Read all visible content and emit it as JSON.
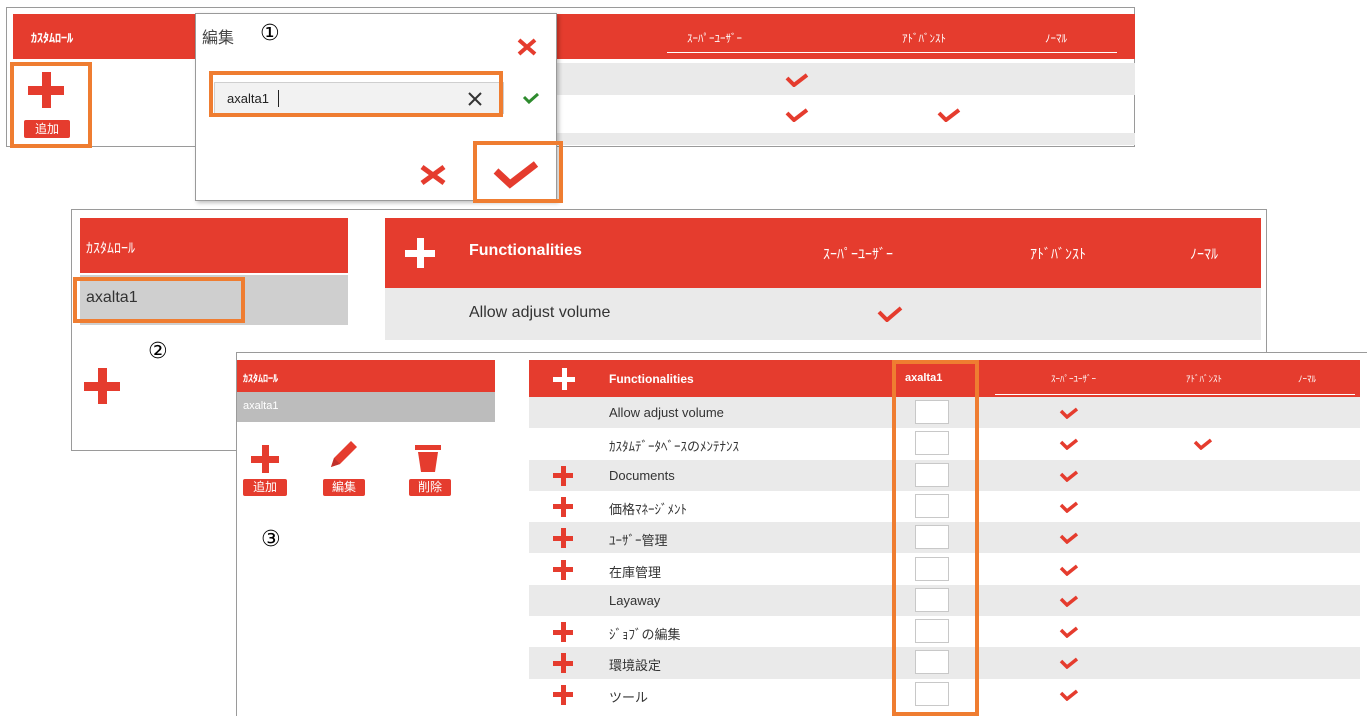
{
  "step_markers": [
    "①",
    "②",
    "③"
  ],
  "colors": {
    "accent": "#e53c2e",
    "highlight": "#ef7d31",
    "green_check": "#2e8b2e",
    "row_grey": "#eaeaea"
  },
  "panel1": {
    "sidebar_title": "ｶｽﾀﾑﾛｰﾙ",
    "add_label": "追加",
    "columns": [
      "ｽｰﾊﾟｰﾕｰｻﾞｰ",
      "ｱﾄﾞﾊﾞﾝｽﾄ",
      "ﾉｰﾏﾙ"
    ]
  },
  "edit_dialog": {
    "title": "編集",
    "input_value": "axalta1",
    "icons": [
      "close-icon",
      "clear-icon",
      "check-icon"
    ]
  },
  "panel2": {
    "sidebar_title": "ｶｽﾀﾑﾛｰﾙ",
    "role_item": "axalta1",
    "header_label": "Functionalities",
    "columns": [
      "ｽｰﾊﾟｰﾕｰｻﾞｰ",
      "ｱﾄﾞﾊﾞﾝｽﾄ",
      "ﾉｰﾏﾙ"
    ],
    "row_label": "Allow adjust volume"
  },
  "panel3": {
    "sidebar_title": "ｶｽﾀﾑﾛｰﾙ",
    "role_item": "axalta1",
    "buttons": {
      "add": "追加",
      "edit": "編集",
      "delete": "削除"
    },
    "header_label": "Functionalities",
    "columns": [
      "axalta1",
      "ｽｰﾊﾟｰﾕｰｻﾞｰ",
      "ｱﾄﾞﾊﾞﾝｽﾄ",
      "ﾉｰﾏﾙ"
    ],
    "rows": [
      {
        "label": "Allow adjust volume",
        "expandable": false,
        "super": true,
        "advanced": false
      },
      {
        "label": "ｶｽﾀﾑﾃﾞｰﾀﾍﾞｰｽのﾒﾝﾃﾅﾝｽ",
        "expandable": false,
        "super": true,
        "advanced": true
      },
      {
        "label": "Documents",
        "expandable": true,
        "super": true,
        "advanced": false
      },
      {
        "label": "価格ﾏﾈｰｼﾞﾒﾝﾄ",
        "expandable": true,
        "super": true,
        "advanced": false
      },
      {
        "label": "ﾕｰｻﾞｰ管理",
        "expandable": true,
        "super": true,
        "advanced": false
      },
      {
        "label": "在庫管理",
        "expandable": true,
        "super": true,
        "advanced": false
      },
      {
        "label": "Layaway",
        "expandable": false,
        "super": true,
        "advanced": false
      },
      {
        "label": "ｼﾞｮﾌﾞの編集",
        "expandable": true,
        "super": true,
        "advanced": false
      },
      {
        "label": "環境設定",
        "expandable": true,
        "super": true,
        "advanced": false
      },
      {
        "label": "ツール",
        "expandable": true,
        "super": true,
        "advanced": false
      }
    ]
  }
}
